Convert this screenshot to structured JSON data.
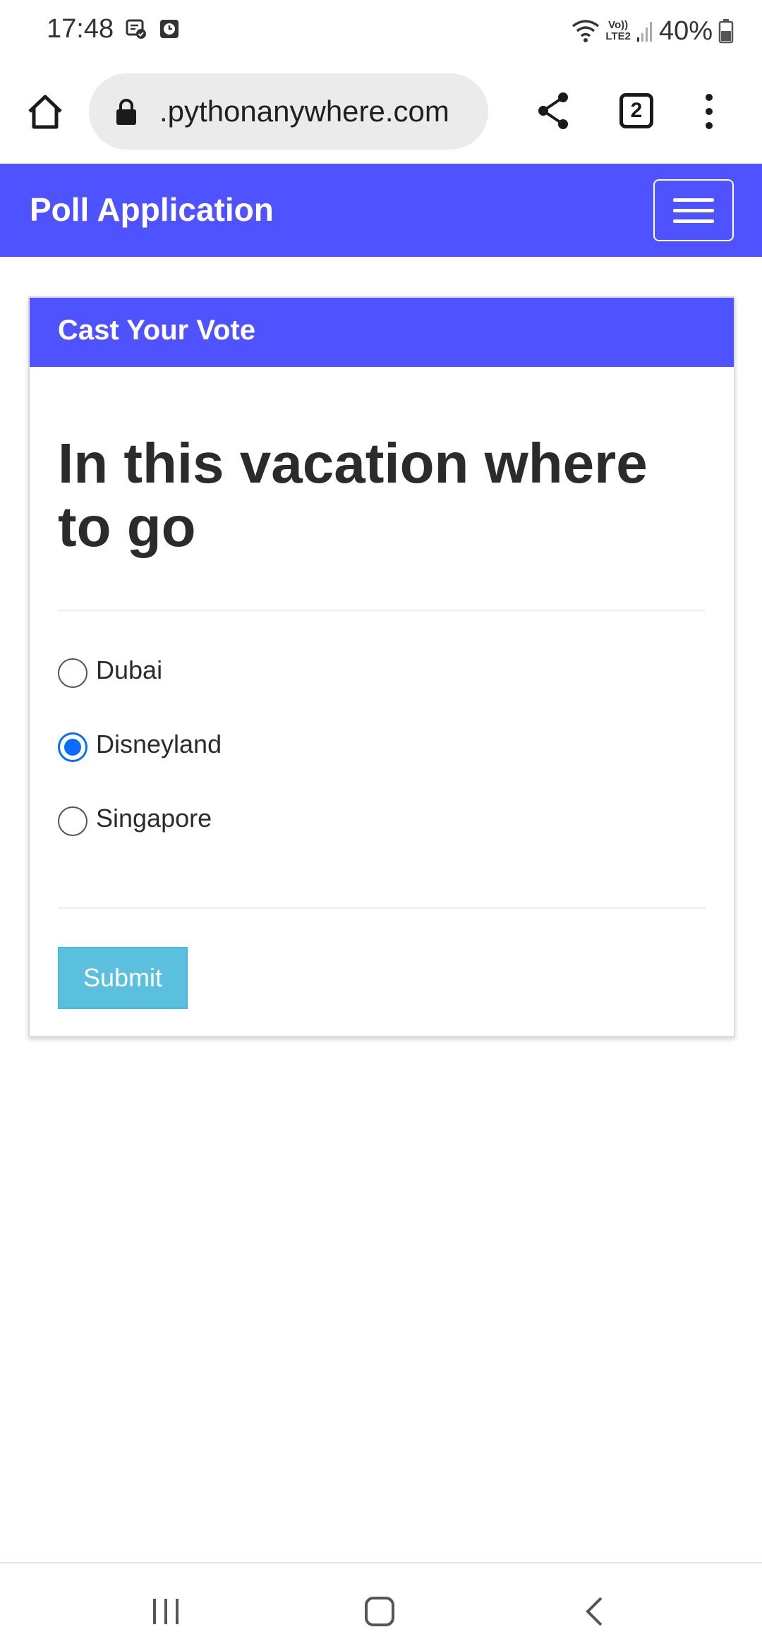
{
  "status_bar": {
    "time": "17:48",
    "volte_line1": "Vo))",
    "volte_line2": "LTE2",
    "battery": "40%"
  },
  "browser": {
    "url": ".pythonanywhere.com",
    "tab_count": "2"
  },
  "navbar": {
    "brand": "Poll Application"
  },
  "card": {
    "header": "Cast Your Vote",
    "question": "In this vacation where to go",
    "choices": [
      {
        "label": "Dubai",
        "checked": false
      },
      {
        "label": "Disneyland",
        "checked": true
      },
      {
        "label": "Singapore",
        "checked": false
      }
    ],
    "submit_label": "Submit"
  },
  "colors": {
    "brand": "#4f52ff",
    "radio_checked": "#0b6dff",
    "submit": "#5bc0de"
  },
  "icons": {
    "status_left": [
      "screenshot-notification-icon",
      "clock-notification-icon"
    ],
    "status_right": [
      "wifi-icon",
      "signal-icon",
      "battery-icon"
    ],
    "toolbar": [
      "home-icon",
      "lock-icon",
      "share-icon",
      "tabs-icon",
      "more-vert-icon"
    ],
    "bottom_nav": [
      "recents-icon",
      "home-nav-icon",
      "back-icon"
    ]
  }
}
